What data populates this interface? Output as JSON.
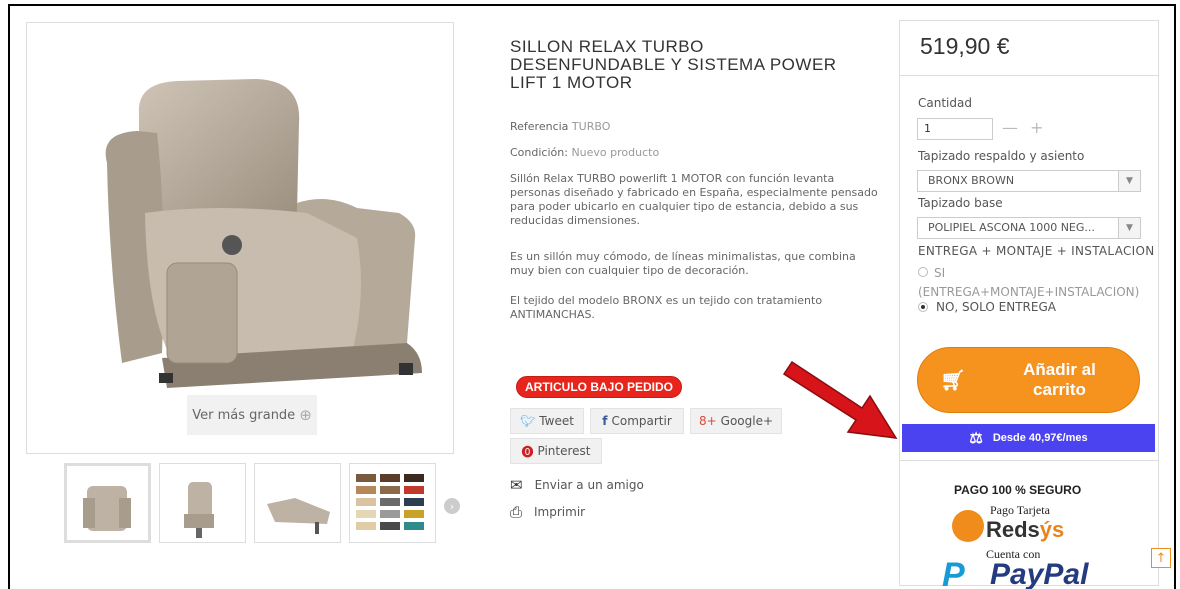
{
  "product": {
    "title": "SILLON RELAX TURBO DESENFUNDABLE Y SISTEMA POWER LIFT 1 MOTOR",
    "reference_label": "Referencia",
    "reference_value": "TURBO",
    "condition_label": "Condición:",
    "condition_value": "Nuevo producto",
    "desc1": "Sillón Relax TURBO powerlift 1 MOTOR con función levanta personas diseñado y fabricado en España, especialmente pensado para poder ubicarlo en cualquier tipo de estancia, debido a sus reducidas dimensiones.",
    "desc2": "Es un sillón muy cómodo, de líneas minimalistas, que combina muy bien con cualquier tipo de decoración.",
    "desc3": "El tejido del modelo BRONX es un tejido con tratamiento ANTIMANCHAS.",
    "badge": "ARTICULO BAJO PEDIDO",
    "zoom_label": "Ver más grande"
  },
  "share": {
    "tweet": "Tweet",
    "compartir": "Compartir",
    "google": "Google+",
    "pinterest": "Pinterest"
  },
  "links": {
    "enviar": "Enviar a un amigo",
    "imprimir": "Imprimir"
  },
  "buy": {
    "price": "519,90 €",
    "cantidad_label": "Cantidad",
    "cantidad_value": "1",
    "tapizado_label": "Tapizado respaldo y asiento",
    "tapizado_value": "BRONX BROWN",
    "base_label": "Tapizado base",
    "base_value": "POLIPIEL ASCONA 1000 NEG...",
    "entrega_label": "ENTREGA + MONTAJE + INSTALACION",
    "opt_si": "SI",
    "opt_si_detail": "(ENTREGA+MONTAJE+INSTALACION)",
    "opt_no": "NO, SOLO ENTREGA",
    "add_line1": "Añadir al",
    "add_line2": "carrito",
    "finance": "Desde 40,97€/mes"
  },
  "payment": {
    "title": "PAGO 100 % SEGURO",
    "pago_tarjeta": "Pago Tarjeta",
    "redsys_a": "Reds",
    "redsys_b": "ýs",
    "cuenta_con": "Cuenta con",
    "paypal": "PayPal"
  },
  "colors": {
    "accent_orange": "#f6931e",
    "finance_blue": "#4b43f0",
    "badge_red": "#e8251c"
  }
}
